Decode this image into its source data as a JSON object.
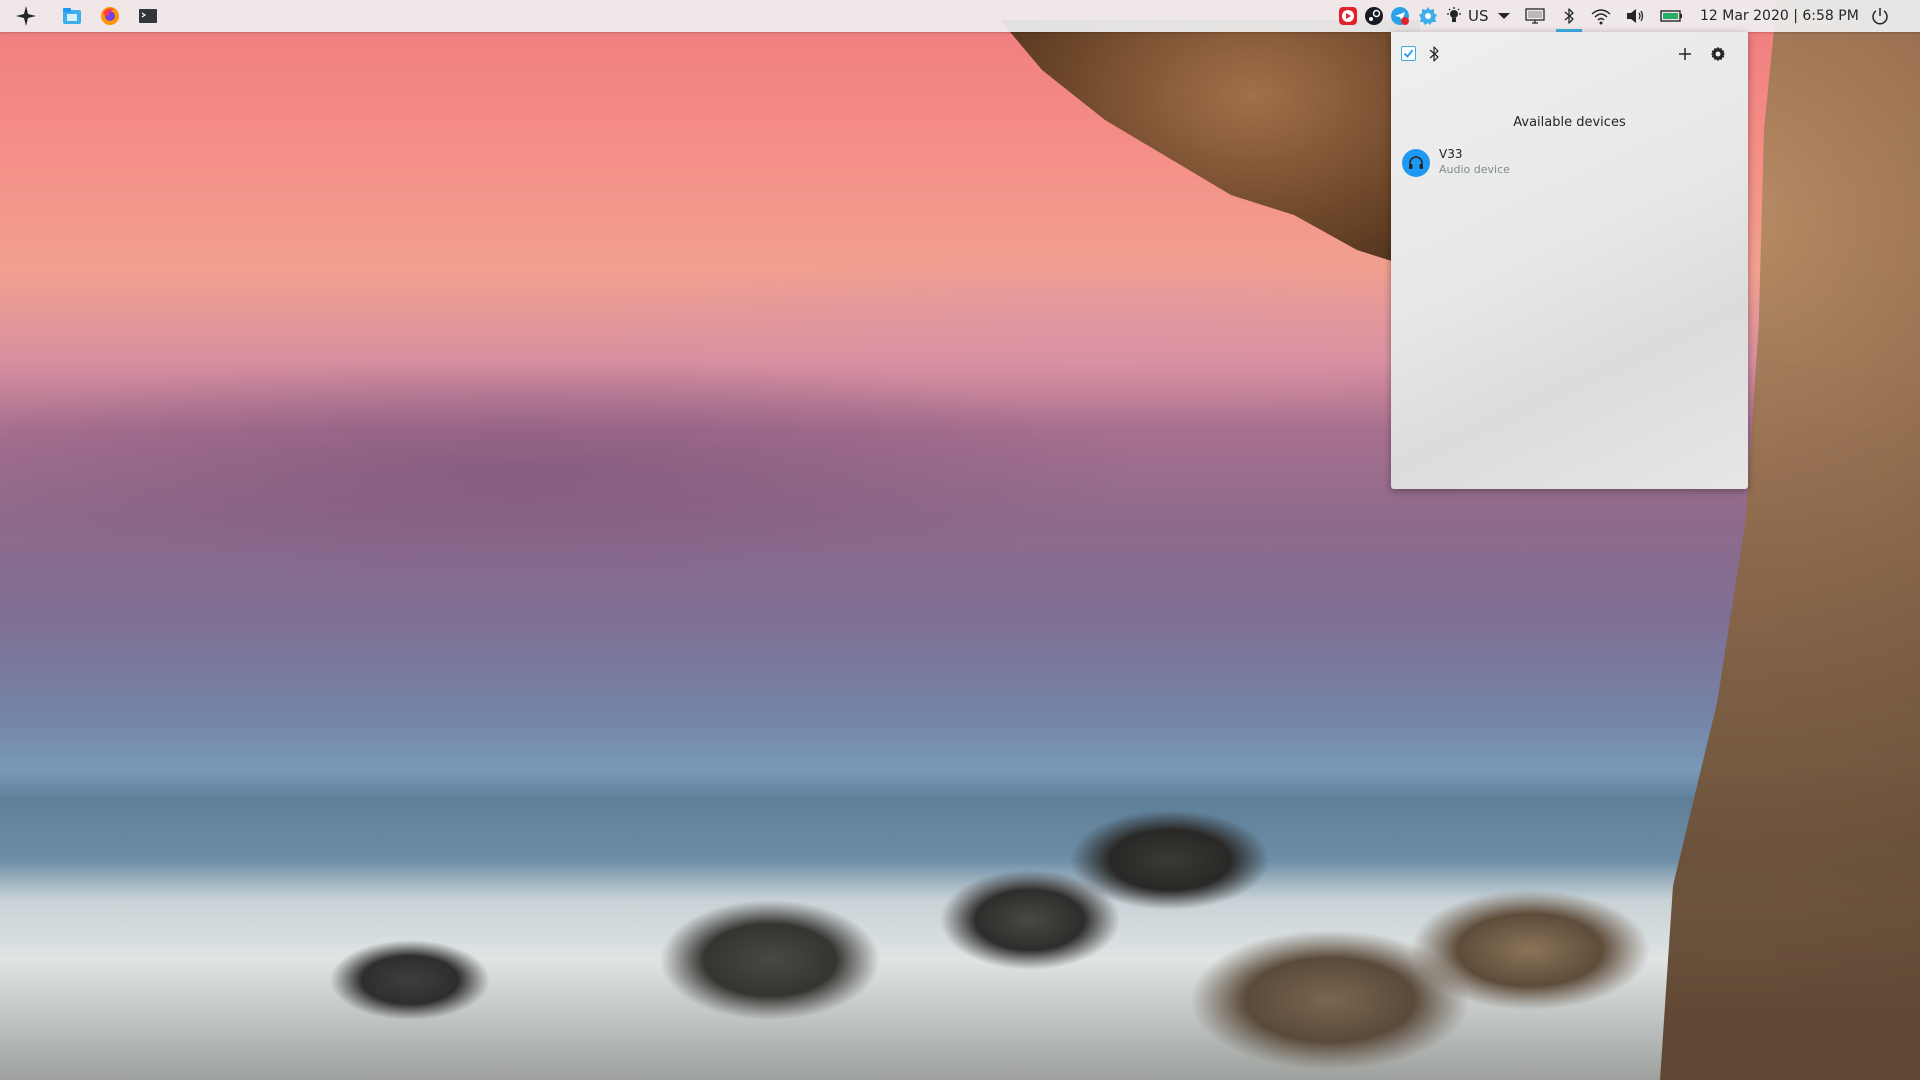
{
  "panel": {
    "launchers": [
      {
        "name": "application-launcher-icon"
      },
      {
        "name": "file-manager-icon"
      },
      {
        "name": "firefox-icon"
      },
      {
        "name": "terminal-icon"
      }
    ],
    "keyboard_layout": "US",
    "clock": "12 Mar 2020 | 6:58 PM",
    "tray_icons": [
      "media-player-icon",
      "steam-icon",
      "chat-app-icon",
      "settings-update-icon",
      "brightness-icon",
      "keyboard-layout",
      "dropdown-arrow-icon",
      "display-icon",
      "bluetooth-icon",
      "wifi-icon",
      "volume-icon",
      "battery-icon",
      "power-icon"
    ],
    "accent_color": "#3daee9"
  },
  "bluetooth_popup": {
    "enabled": true,
    "section_title": "Available devices",
    "devices": [
      {
        "name": "V33",
        "type": "Audio device",
        "icon": "headset-icon"
      }
    ],
    "device_icon_color": "#1d99f3"
  }
}
